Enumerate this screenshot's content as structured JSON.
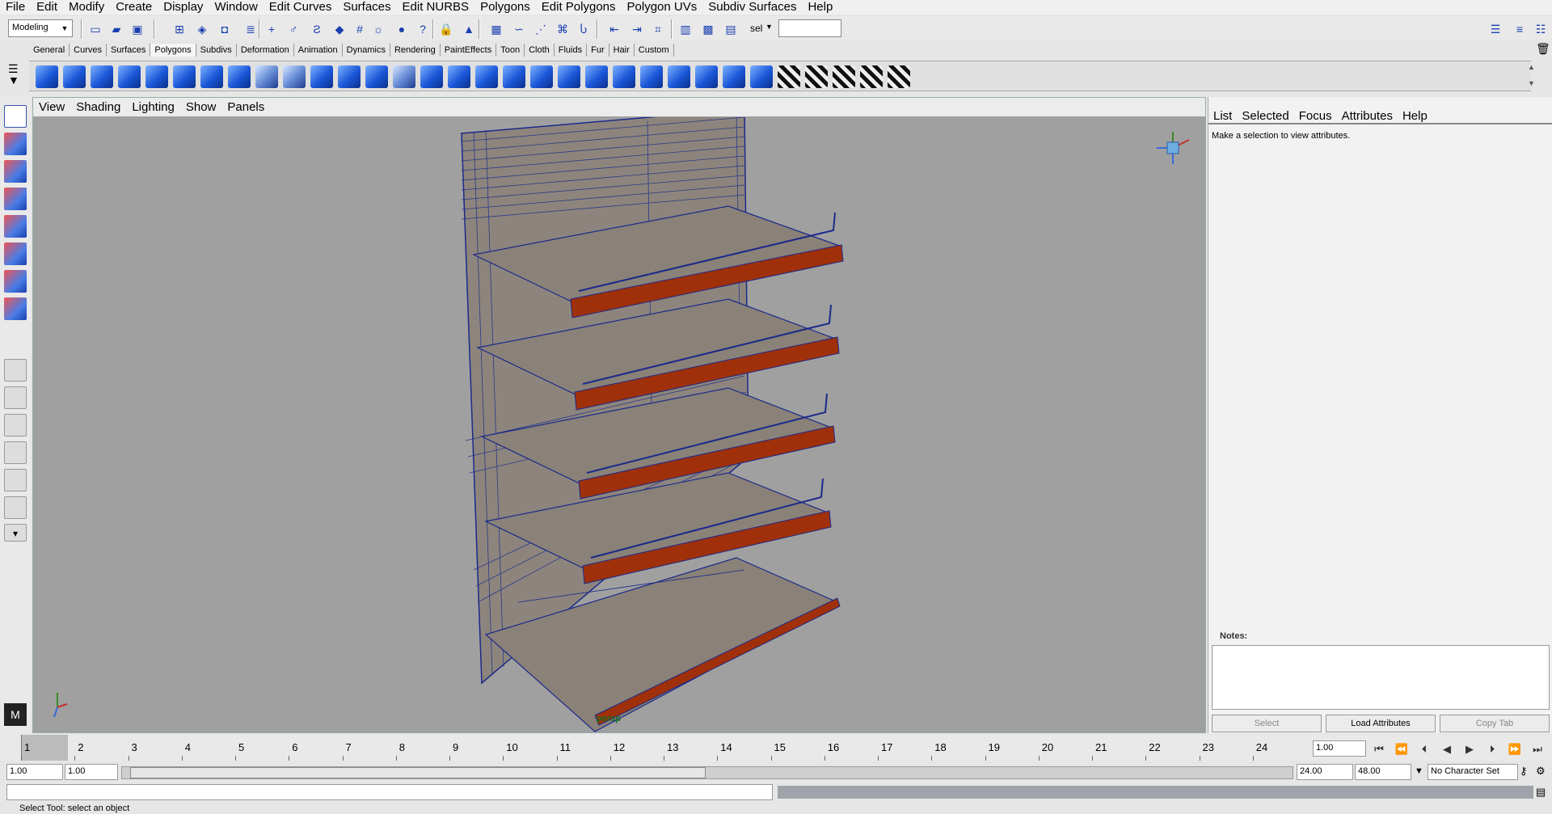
{
  "menubar": {
    "items": [
      "File",
      "Edit",
      "Modify",
      "Create",
      "Display",
      "Window",
      "Edit Curves",
      "Surfaces",
      "Edit NURBS",
      "Polygons",
      "Edit Polygons",
      "Polygon UVs",
      "Subdiv Surfaces",
      "Help"
    ]
  },
  "statusline": {
    "mode_value": "Modeling",
    "select_label": "sel"
  },
  "shelf_tabs": [
    "General",
    "Curves",
    "Surfaces",
    "Polygons",
    "Subdivs",
    "Deformation",
    "Animation",
    "Dynamics",
    "Rendering",
    "PaintEffects",
    "Toon",
    "Cloth",
    "Fluids",
    "Fur",
    "Hair",
    "Custom"
  ],
  "shelf_tabs_active": "Polygons",
  "viewport": {
    "menu": [
      "View",
      "Shading",
      "Lighting",
      "Show",
      "Panels"
    ],
    "camera_label": "persp",
    "colors": {
      "background": "#a0a0a0",
      "wireframe": "#1b2a8a",
      "shelf_surface": "#8a8178",
      "trim": "#a0300a"
    }
  },
  "attribute_editor": {
    "menu": [
      "List",
      "Selected",
      "Focus",
      "Attributes",
      "Help"
    ],
    "message": "Make a selection to view attributes.",
    "notes_label": "Notes:",
    "buttons": {
      "select": "Select",
      "load_attributes": "Load Attributes",
      "copy_tab": "Copy Tab"
    }
  },
  "timeslider": {
    "ticks": [
      "1",
      "2",
      "3",
      "4",
      "5",
      "6",
      "7",
      "8",
      "9",
      "10",
      "11",
      "12",
      "13",
      "14",
      "15",
      "16",
      "17",
      "18",
      "19",
      "20",
      "21",
      "22",
      "23",
      "24"
    ],
    "current_time": "1.00"
  },
  "rangeslider": {
    "start": "1.00",
    "playback_start": "1.00",
    "playback_end": "24.00",
    "end": "48.00",
    "character_set": "No Character Set"
  },
  "helpline": {
    "text": "Select Tool: select an object"
  }
}
